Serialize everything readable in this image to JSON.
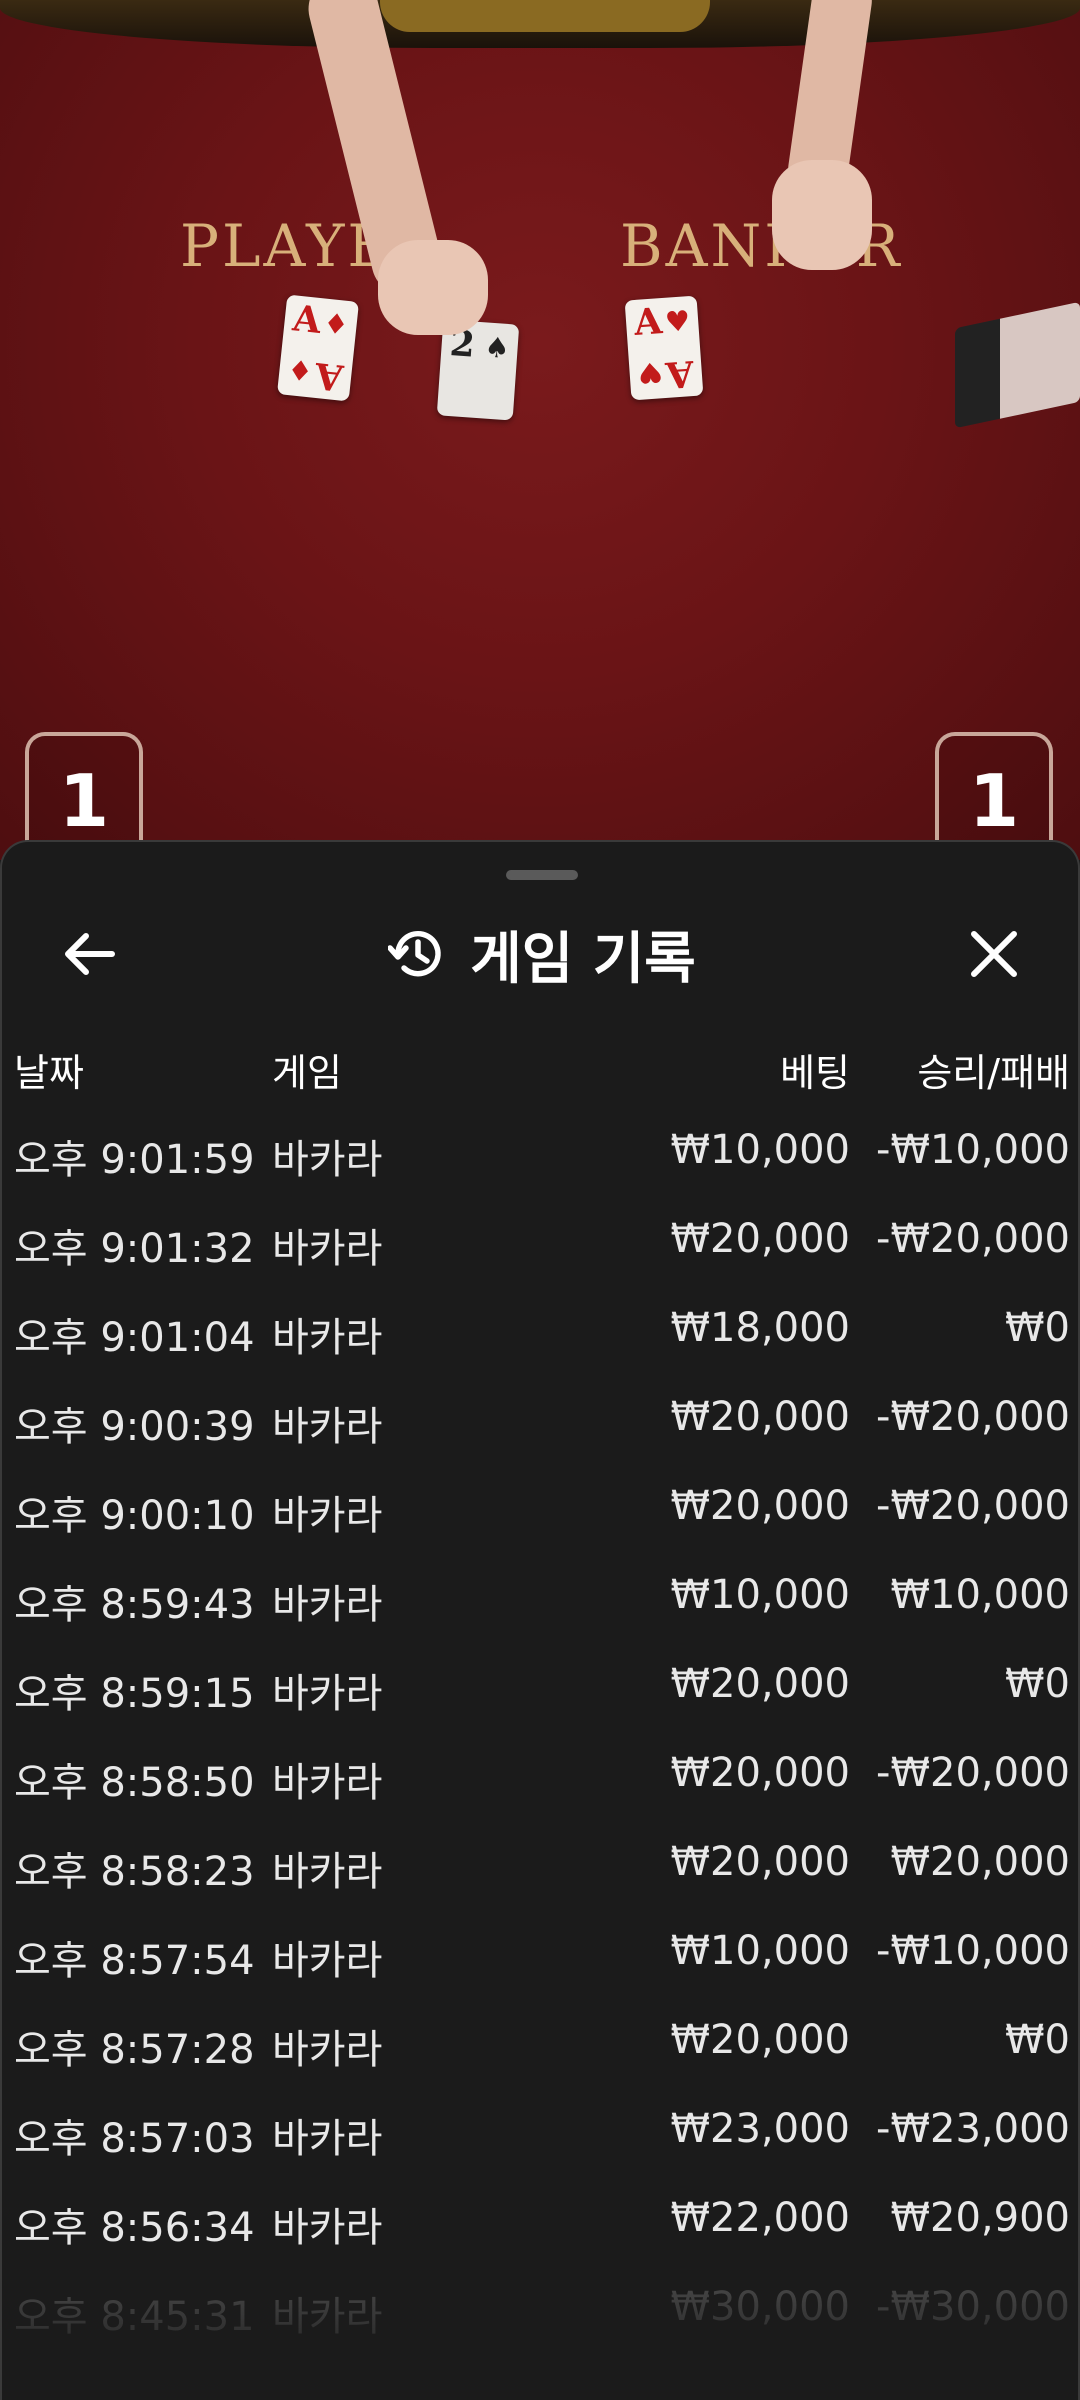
{
  "video": {
    "player_label": "PLAYE",
    "banker_label": "BANKER",
    "cards": [
      {
        "rank": "A",
        "suit": "♦"
      },
      {
        "rank": "2",
        "suit": "♠"
      },
      {
        "rank": "A",
        "suit": "♥"
      }
    ],
    "seat_left": "1",
    "seat_right": "1"
  },
  "sheet": {
    "title": "게임 기록",
    "icons": {
      "back": "arrow-left-icon",
      "history": "history-icon",
      "close": "close-icon"
    }
  },
  "table": {
    "headers": {
      "date": "날짜",
      "game": "게임",
      "bet": "베팅",
      "winloss": "승리/패배"
    },
    "rows": [
      {
        "date": "오후 9:01:59",
        "game": "바카라",
        "bet": "₩10,000",
        "winloss": "-₩10,000"
      },
      {
        "date": "오후 9:01:32",
        "game": "바카라",
        "bet": "₩20,000",
        "winloss": "-₩20,000"
      },
      {
        "date": "오후 9:01:04",
        "game": "바카라",
        "bet": "₩18,000",
        "winloss": "₩0"
      },
      {
        "date": "오후 9:00:39",
        "game": "바카라",
        "bet": "₩20,000",
        "winloss": "-₩20,000"
      },
      {
        "date": "오후 9:00:10",
        "game": "바카라",
        "bet": "₩20,000",
        "winloss": "-₩20,000"
      },
      {
        "date": "오후 8:59:43",
        "game": "바카라",
        "bet": "₩10,000",
        "winloss": "₩10,000"
      },
      {
        "date": "오후 8:59:15",
        "game": "바카라",
        "bet": "₩20,000",
        "winloss": "₩0"
      },
      {
        "date": "오후 8:58:50",
        "game": "바카라",
        "bet": "₩20,000",
        "winloss": "-₩20,000"
      },
      {
        "date": "오후 8:58:23",
        "game": "바카라",
        "bet": "₩20,000",
        "winloss": "₩20,000"
      },
      {
        "date": "오후 8:57:54",
        "game": "바카라",
        "bet": "₩10,000",
        "winloss": "-₩10,000"
      },
      {
        "date": "오후 8:57:28",
        "game": "바카라",
        "bet": "₩20,000",
        "winloss": "₩0"
      },
      {
        "date": "오후 8:57:03",
        "game": "바카라",
        "bet": "₩23,000",
        "winloss": "-₩23,000"
      },
      {
        "date": "오후 8:56:34",
        "game": "바카라",
        "bet": "₩22,000",
        "winloss": "₩20,900"
      },
      {
        "date": "오후 8:45:31",
        "game": "바카라",
        "bet": "₩30,000",
        "winloss": "-₩30,000"
      }
    ]
  }
}
